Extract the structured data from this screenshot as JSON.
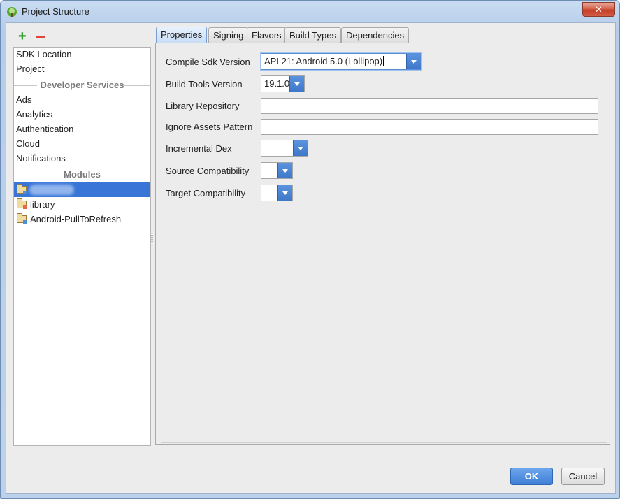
{
  "window": {
    "title": "Project Structure",
    "close_label": "✕"
  },
  "left_panel": {
    "add_label": "+",
    "items_top": [
      "SDK Location",
      "Project"
    ],
    "developer_services_header": "Developer Services",
    "services": [
      "Ads",
      "Analytics",
      "Authentication",
      "Cloud",
      "Notifications"
    ],
    "modules_header": "Modules",
    "modules": [
      {
        "label": "",
        "selected": true,
        "blurred": true
      },
      {
        "label": "library",
        "selected": false
      },
      {
        "label": "Android-PullToRefresh",
        "selected": false
      }
    ]
  },
  "tabs": [
    {
      "label": "Properties",
      "active": true
    },
    {
      "label": "Signing",
      "active": false
    },
    {
      "label": "Flavors",
      "active": false
    },
    {
      "label": "Build Types",
      "active": false
    },
    {
      "label": "Dependencies",
      "active": false
    }
  ],
  "properties": {
    "compile_sdk": {
      "label": "Compile Sdk Version",
      "value": "API 21: Android 5.0 (Lollipop)"
    },
    "build_tools": {
      "label": "Build Tools Version",
      "value": "19.1.0"
    },
    "library_repository": {
      "label": "Library Repository",
      "value": ""
    },
    "ignore_assets": {
      "label": "Ignore Assets Pattern",
      "value": ""
    },
    "incremental_dex": {
      "label": "Incremental Dex",
      "value": ""
    },
    "source_compat": {
      "label": "Source Compatibility",
      "value": ""
    },
    "target_compat": {
      "label": "Target Compatibility",
      "value": ""
    }
  },
  "buttons": {
    "ok": "OK",
    "cancel": "Cancel"
  },
  "colors": {
    "selection": "#3875d7",
    "accent": "#3f7fd6"
  }
}
